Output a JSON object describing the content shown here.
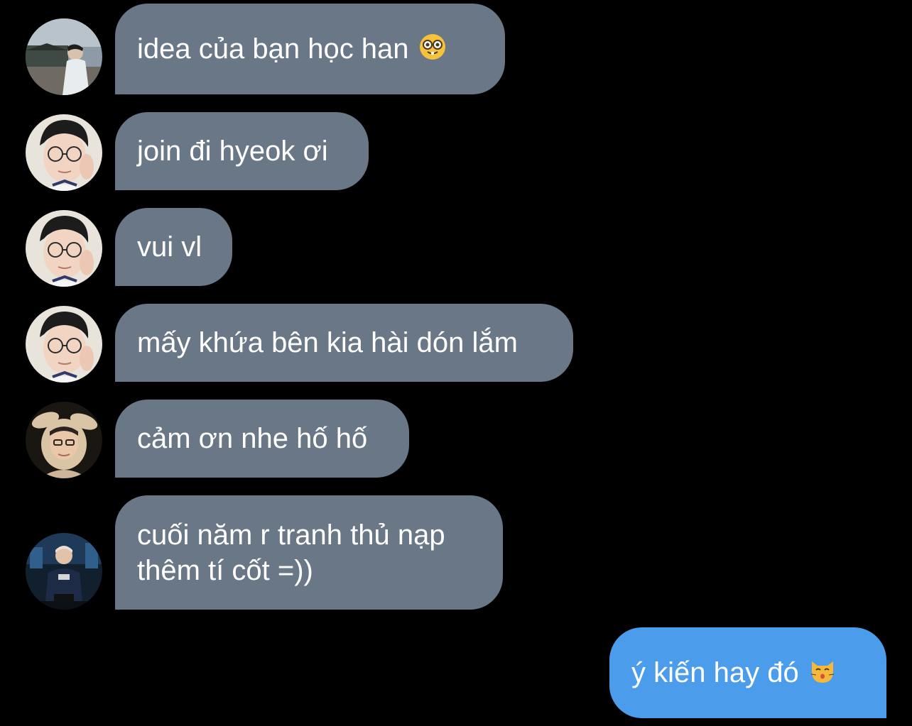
{
  "conversation": {
    "messages": [
      {
        "sender": "other",
        "avatar": "avatar-outdoor",
        "text": "idea của bạn học han",
        "emoji": "nerd-face-emoji"
      },
      {
        "sender": "other",
        "avatar": "avatar-glasses",
        "text": "join đi hyeok ơi"
      },
      {
        "sender": "other",
        "avatar": "avatar-glasses",
        "text": "vui vl"
      },
      {
        "sender": "other",
        "avatar": "avatar-glasses",
        "text": "mấy khứa bên kia hài dón lắm"
      },
      {
        "sender": "other",
        "avatar": "avatar-bunny-hood",
        "text": "cảm ơn nhe hố hố"
      },
      {
        "sender": "other",
        "avatar": "avatar-stage",
        "text_line1": "cuối năm r tranh thủ nạp",
        "text_line2": "thêm tí cốt =))"
      },
      {
        "sender": "me",
        "text": "ý kiến hay đó",
        "emoji": "kissing-cat-emoji"
      }
    ]
  },
  "colors": {
    "background": "#000000",
    "incoming_bubble": "#6a7786",
    "outgoing_bubble": "#4c9cec",
    "text": "#ffffff"
  }
}
